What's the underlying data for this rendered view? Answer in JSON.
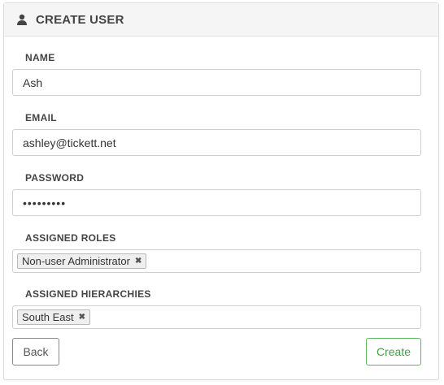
{
  "header": {
    "icon": "user-icon",
    "title": "CREATE USER"
  },
  "form": {
    "name": {
      "label": "NAME",
      "value": "Ash"
    },
    "email": {
      "label": "EMAIL",
      "value": "ashley@tickett.net"
    },
    "password": {
      "label": "PASSWORD",
      "value": "•••••••••"
    },
    "assigned_roles": {
      "label": "ASSIGNED ROLES",
      "tags": [
        "Non-user Administrator"
      ]
    },
    "assigned_hierarchies": {
      "label": "ASSIGNED HIERARCHIES",
      "tags": [
        "South East"
      ]
    }
  },
  "actions": {
    "back_label": "Back",
    "create_label": "Create"
  },
  "colors": {
    "create_accent": "#5cb85c",
    "header_bg": "#f5f5f5"
  }
}
